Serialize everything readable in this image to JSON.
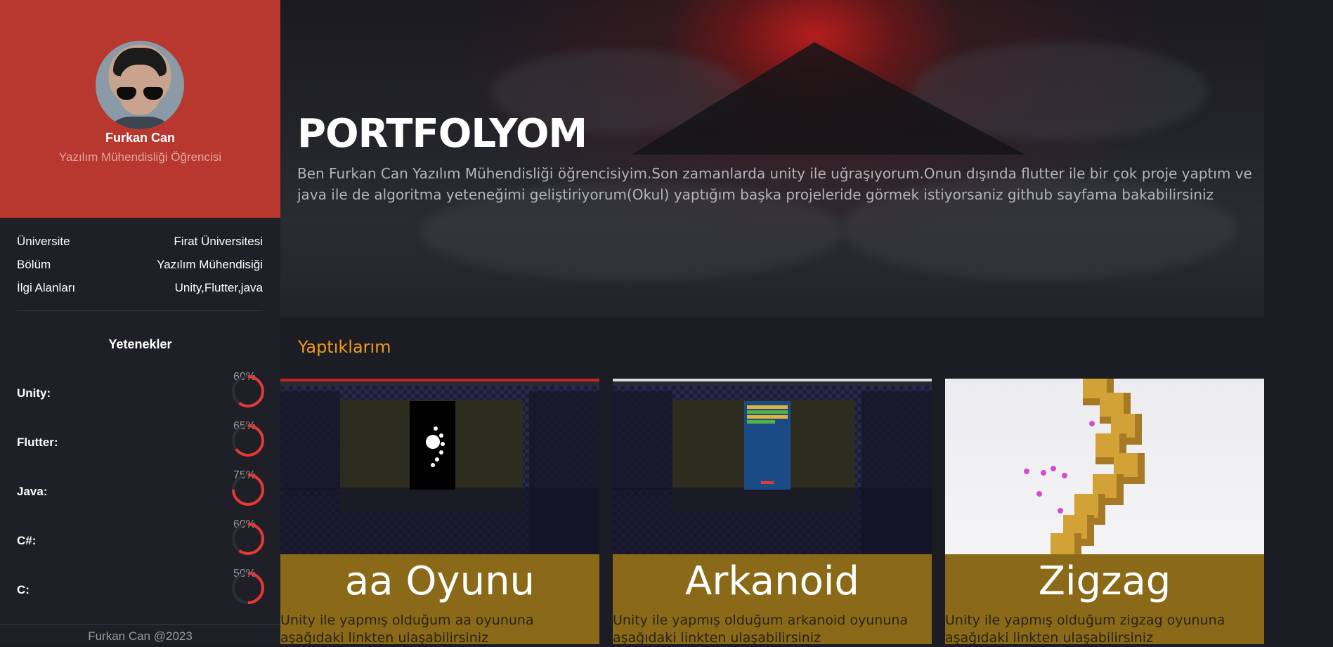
{
  "profile": {
    "name": "Furkan Can",
    "title": "Yazılım Mühendisliği Öğrencisi"
  },
  "info": [
    {
      "label": "Üniversite",
      "value": "Firat Üniversitesi"
    },
    {
      "label": "Bölüm",
      "value": "Yazılım Mühendisiği"
    },
    {
      "label": "İlgi Alanları",
      "value": "Unity,Flutter,java"
    }
  ],
  "skills": {
    "title": "Yetenekler",
    "items": [
      {
        "name": "Unity:",
        "percent": "60%",
        "value": 60
      },
      {
        "name": "Flutter:",
        "percent": "65%",
        "value": 65
      },
      {
        "name": "Java:",
        "percent": "75%",
        "value": 75
      },
      {
        "name": "C#:",
        "percent": "60%",
        "value": 60
      },
      {
        "name": "C:",
        "percent": "50%",
        "value": 50
      }
    ]
  },
  "footer": {
    "text": "Furkan Can @2023"
  },
  "hero": {
    "title": "PORTFOLYOM",
    "description": "Ben Furkan Can Yazılım Mühendisliği öğrencisiyim.Son zamanlarda unity ile uğraşıyorum.Onun dışında flutter ile bir çok proje yaptım ve java ile de algoritma yeteneğimi geliştiriyorum(Okul) yaptığım başka projeleride görmek istiyorsaniz github sayfama bakabilirsiniz"
  },
  "projects": {
    "title": "Yaptıklarım",
    "items": [
      {
        "title": "aa Oyunu",
        "description": "Unity ile yapmış olduğum aa oyununa aşağıdaki linkten ulaşabilirsiniz"
      },
      {
        "title": "Arkanoid",
        "description": "Unity ile yapmış olduğum arkanoid oyununa aşağıdaki linkten ulaşabilirsiniz"
      },
      {
        "title": "Zigzag",
        "description": "Unity ile yapmış olduğum zigzag oyununa aşağıdaki linkten ulaşabilirsiniz"
      }
    ]
  },
  "colors": {
    "sidebar_accent": "#b8372f",
    "skill_ring": "#e53935",
    "section_title": "#f09a1a",
    "card_caption": "#8a6a18"
  }
}
